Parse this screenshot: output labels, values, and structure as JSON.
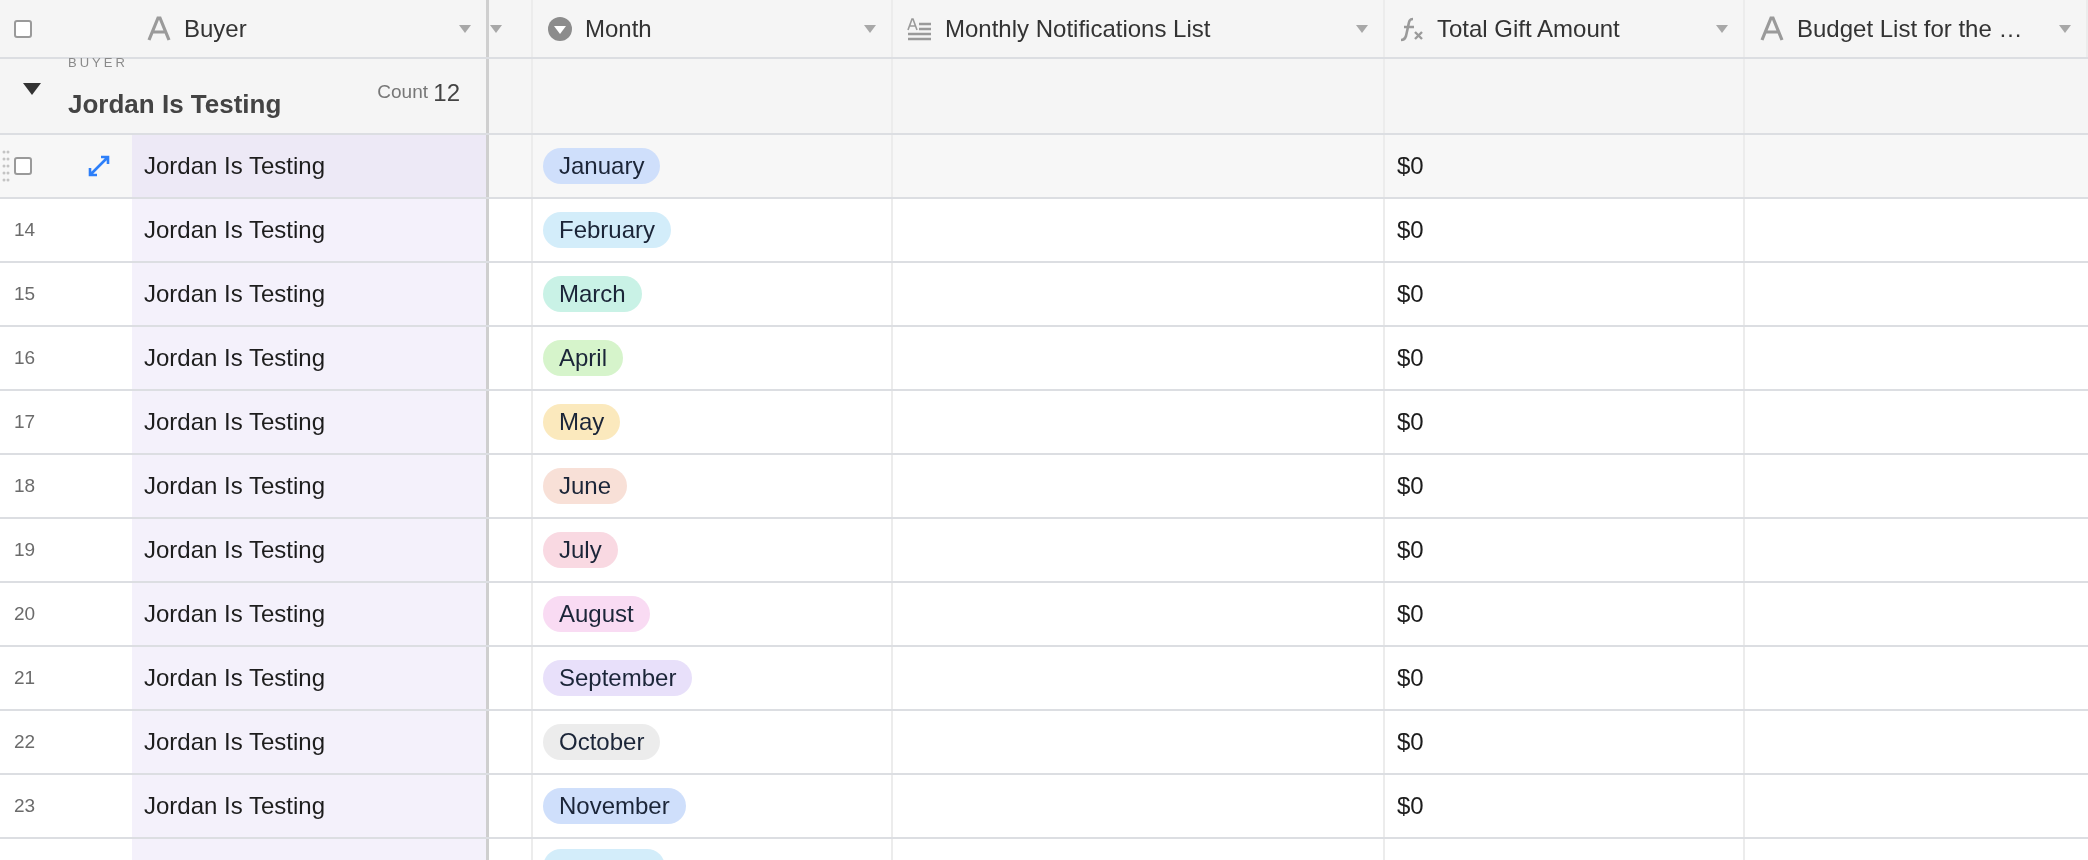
{
  "header": {
    "checked": false,
    "columns": [
      {
        "kind": "text",
        "label": "Buyer"
      },
      {
        "kind": "narrow"
      },
      {
        "kind": "select",
        "label": "Month"
      },
      {
        "kind": "longtext",
        "label": "Monthly Notifications List"
      },
      {
        "kind": "formula",
        "label": "Total Gift Amount"
      },
      {
        "kind": "text",
        "label": "Budget List for the …"
      }
    ]
  },
  "group": {
    "field_label": "BUYER",
    "title": "Jordan Is Testing",
    "expanded": true,
    "count_label": "Count",
    "count": "12"
  },
  "rows": [
    {
      "hovered": true,
      "checked": false,
      "buyer": "Jordan Is Testing",
      "month": "January",
      "color": "#cfdffb",
      "total": "$0"
    },
    {
      "hovered": false,
      "number": "14",
      "buyer": "Jordan Is Testing",
      "month": "February",
      "color": "#d3edfa",
      "total": "$0"
    },
    {
      "hovered": false,
      "number": "15",
      "buyer": "Jordan Is Testing",
      "month": "March",
      "color": "#c9f2e6",
      "total": "$0"
    },
    {
      "hovered": false,
      "number": "16",
      "buyer": "Jordan Is Testing",
      "month": "April",
      "color": "#d6f4cb",
      "total": "$0"
    },
    {
      "hovered": false,
      "number": "17",
      "buyer": "Jordan Is Testing",
      "month": "May",
      "color": "#fbe9bd",
      "total": "$0"
    },
    {
      "hovered": false,
      "number": "18",
      "buyer": "Jordan Is Testing",
      "month": "June",
      "color": "#f8e0d7",
      "total": "$0"
    },
    {
      "hovered": false,
      "number": "19",
      "buyer": "Jordan Is Testing",
      "month": "July",
      "color": "#f9d9e2",
      "total": "$0"
    },
    {
      "hovered": false,
      "number": "20",
      "buyer": "Jordan Is Testing",
      "month": "August",
      "color": "#f9dbf3",
      "total": "$0"
    },
    {
      "hovered": false,
      "number": "21",
      "buyer": "Jordan Is Testing",
      "month": "September",
      "color": "#e8e0fa",
      "total": "$0"
    },
    {
      "hovered": false,
      "number": "22",
      "buyer": "Jordan Is Testing",
      "month": "October",
      "color": "#ececec",
      "total": "$0"
    },
    {
      "hovered": false,
      "number": "23",
      "buyer": "Jordan Is Testing",
      "month": "November",
      "color": "#cfdffb",
      "total": "$0"
    },
    {
      "hovered": false,
      "color": "#d3edfa"
    }
  ]
}
